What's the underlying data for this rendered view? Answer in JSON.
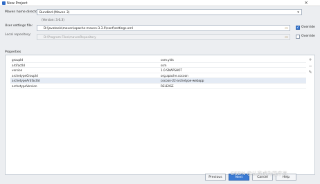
{
  "window": {
    "title": "New Project",
    "close_glyph": "×"
  },
  "form": {
    "maven_home": {
      "label": "Maven home directory:",
      "value": "Bundled (Maven 3)",
      "version_note": "(Version: 3.6.3)"
    },
    "user_settings": {
      "label": "User settings file:",
      "value": "D:\\javatools\\maven\\apache-maven-3.3.9\\conf\\settings.xml",
      "override_label": "Override",
      "override_checked": true
    },
    "local_repository": {
      "label": "Local repository:",
      "value": "D:\\Program Files\\mavenRepository",
      "override_label": "Override",
      "override_checked": false
    }
  },
  "properties": {
    "title": "Properties",
    "rows": [
      {
        "key": "groupId",
        "value": "com.yids"
      },
      {
        "key": "artifactId",
        "value": "ssm"
      },
      {
        "key": "version",
        "value": "1.0-SNAPSHOT"
      },
      {
        "key": "archetypeGroupId",
        "value": "org.apache.cocoon"
      },
      {
        "key": "archetypeArtifactId",
        "value": "cocoon-22-archetype-webapp"
      },
      {
        "key": "archetypeVersion",
        "value": "RELEASE"
      }
    ],
    "tools": {
      "add": "+",
      "remove": "−",
      "edit": "✎"
    }
  },
  "buttons": {
    "previous": "Previous",
    "next": "Next",
    "cancel": "Cancel",
    "help": "Help"
  },
  "watermark": "CSDN @认真成为程序员",
  "colors": {
    "accent": "#3a7bd5",
    "window_bg": "#eceef1"
  }
}
